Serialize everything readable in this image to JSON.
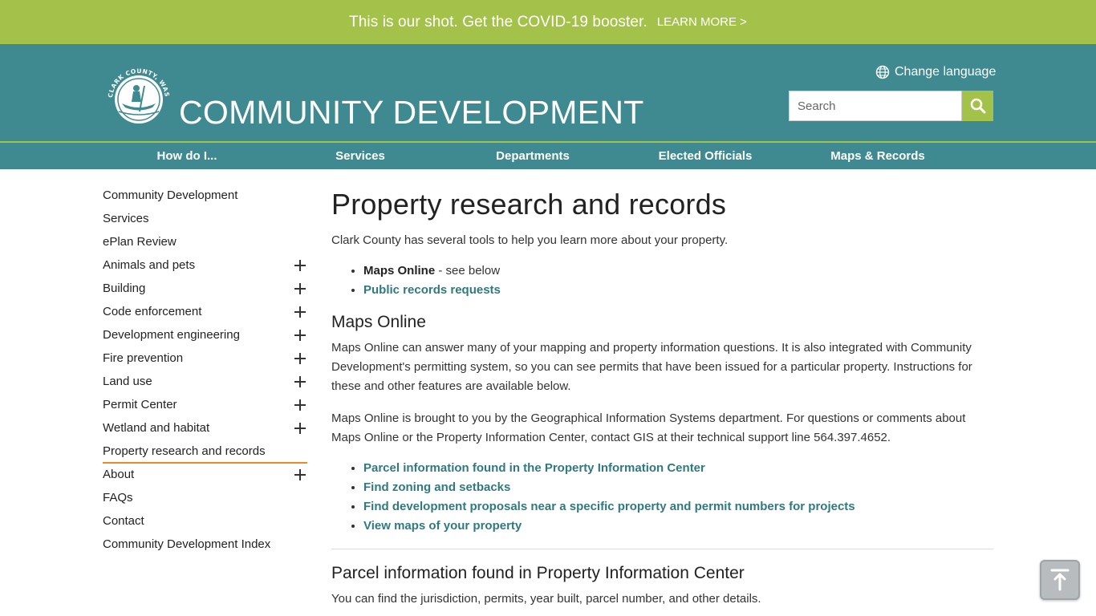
{
  "banner": {
    "message": "This is our shot. Get the COVID-19 booster.",
    "link": "LEARN MORE >"
  },
  "header": {
    "logo_text": "CLARK COUNTY, WASHINGTON",
    "site_title": "COMMUNITY DEVELOPMENT",
    "language": "Change language",
    "search_placeholder": "Search"
  },
  "nav": [
    {
      "label": "How do I...",
      "center": 233
    },
    {
      "label": "Services",
      "center": 449
    },
    {
      "label": "Departments",
      "center": 664
    },
    {
      "label": "Elected Officials",
      "center": 879
    },
    {
      "label": "Maps & Records",
      "center": 1094
    }
  ],
  "sidebar": {
    "items": [
      {
        "label": "Community Development",
        "expand": false
      },
      {
        "label": "Services",
        "expand": false
      },
      {
        "label": "ePlan Review",
        "expand": false
      },
      {
        "label": "Animals and pets",
        "expand": true
      },
      {
        "label": "Building",
        "expand": true
      },
      {
        "label": "Code enforcement",
        "expand": true
      },
      {
        "label": "Development engineering",
        "expand": true
      },
      {
        "label": "Fire prevention",
        "expand": true
      },
      {
        "label": "Land use",
        "expand": true
      },
      {
        "label": "Permit Center",
        "expand": true
      },
      {
        "label": "Wetland and habitat",
        "expand": true
      },
      {
        "label": "Property research and records",
        "expand": false,
        "active": true
      },
      {
        "label": "About",
        "expand": true
      },
      {
        "label": "FAQs",
        "expand": false
      },
      {
        "label": "Contact",
        "expand": false
      },
      {
        "label": "Community Development Index",
        "expand": false
      }
    ]
  },
  "main": {
    "title": "Property research and records",
    "intro": "Clark County has several tools to help you learn more about your property.",
    "tools": {
      "maps_online_label": "Maps Online",
      "maps_online_suffix": " - see below",
      "public_records": "Public records requests"
    },
    "maps_heading": "Maps Online",
    "maps_para1": "Maps Online can answer many of your mapping and property information questions. It is also integrated with Community Development's permitting system, so you can see permits that have been issued for a particular property. Instructions for these and other features are available below.",
    "maps_para2": "Maps Online is brought to you by the Geographical Information Systems department. For questions or comments about Maps Online or the Property Information Center, contact GIS at their technical support line 564.397.4652.",
    "links": [
      "Parcel information found in the Property Information Center",
      "Find zoning and setbacks",
      "Find development proposals near a specific property and permit numbers for projects",
      "View maps of your property"
    ],
    "parcel_heading": "Parcel information found in Property Information Center",
    "parcel_para": "You can find the jurisdiction, permits, year built, parcel number, and other details."
  },
  "colors": {
    "banner": "#a4c24a",
    "header": "#3f8a91",
    "link": "#2f7a80",
    "active_underline": "#e98a2b"
  }
}
